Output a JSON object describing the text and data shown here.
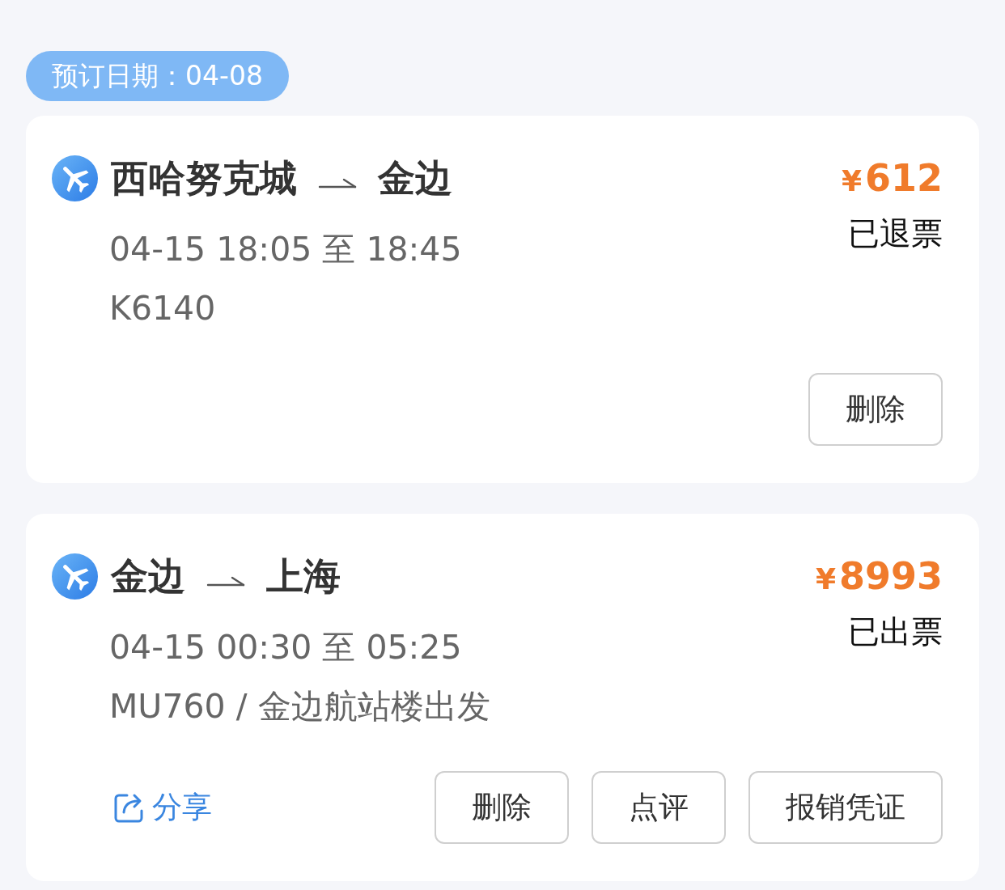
{
  "booking_date": {
    "label": "预订日期：04-08"
  },
  "orders": [
    {
      "from": "西哈努克城",
      "to": "金边",
      "price": {
        "currency": "¥",
        "amount": "612"
      },
      "status": "已退票",
      "schedule": "04-15 18:05 至 18:45",
      "detail": "K6140",
      "buttons": [
        "删除"
      ]
    },
    {
      "from": "金边",
      "to": "上海",
      "price": {
        "currency": "¥",
        "amount": "8993"
      },
      "status": "已出票",
      "schedule": "04-15 00:30 至 05:25",
      "detail": "MU760 / 金边航站楼出发",
      "share": {
        "label": "分享"
      },
      "buttons": [
        "删除",
        "点评",
        "报销凭证"
      ]
    }
  ]
}
